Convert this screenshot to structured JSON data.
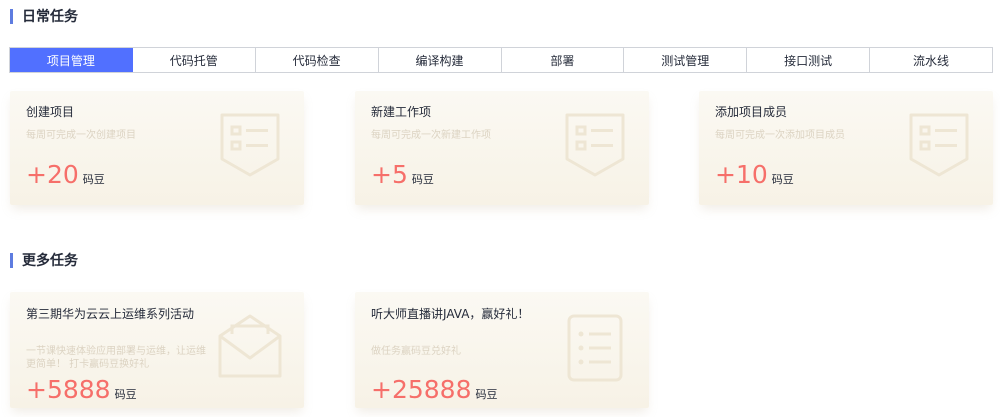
{
  "sections": {
    "daily": "日常任务",
    "more": "更多任务"
  },
  "tabs": [
    {
      "label": "项目管理",
      "active": true
    },
    {
      "label": "代码托管",
      "active": false
    },
    {
      "label": "代码检查",
      "active": false
    },
    {
      "label": "编译构建",
      "active": false
    },
    {
      "label": "部署",
      "active": false
    },
    {
      "label": "测试管理",
      "active": false
    },
    {
      "label": "接口测试",
      "active": false
    },
    {
      "label": "流水线",
      "active": false
    }
  ],
  "daily_tasks": [
    {
      "title": "创建项目",
      "desc": "每周可完成一次创建项目",
      "reward": "+20",
      "unit": "码豆",
      "icon": "form-list-icon"
    },
    {
      "title": "新建工作项",
      "desc": "每周可完成一次新建工作项",
      "reward": "+5",
      "unit": "码豆",
      "icon": "form-list-icon"
    },
    {
      "title": "添加项目成员",
      "desc": "每周可完成一次添加项目成员",
      "reward": "+10",
      "unit": "码豆",
      "icon": "form-list-icon"
    }
  ],
  "more_tasks": [
    {
      "title": "第三期华为云云上运维系列活动",
      "desc": "一节课快速体验应用部署与运维，让运维更简单！ 打卡赢码豆换好礼",
      "reward": "+5888",
      "unit": "码豆",
      "icon": "envelope-icon"
    },
    {
      "title": "听大师直播讲JAVA，赢好礼！",
      "desc": "做任务赢码豆兑好礼",
      "reward": "+25888",
      "unit": "码豆",
      "icon": "document-list-icon"
    }
  ],
  "colors": {
    "accent": "#5170ff",
    "section_bar": "#5e7ce0",
    "reward": "#f66f6a"
  }
}
